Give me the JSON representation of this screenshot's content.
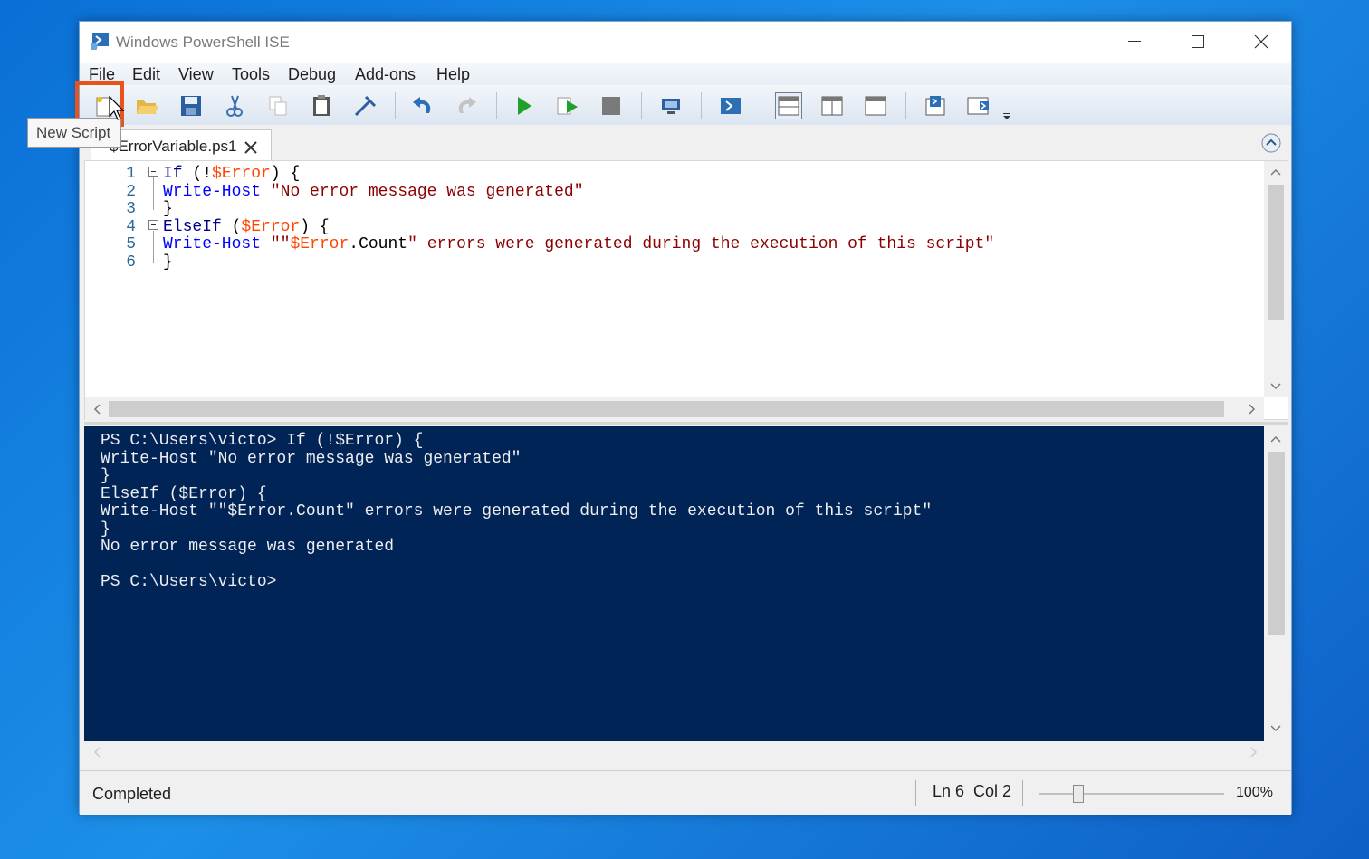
{
  "window": {
    "title": "Windows PowerShell ISE"
  },
  "menu": [
    "File",
    "Edit",
    "View",
    "Tools",
    "Debug",
    "Add-ons",
    "Help"
  ],
  "toolbar": {
    "tooltip": "New Script",
    "buttons": [
      "new-script",
      "open",
      "save",
      "cut",
      "copy",
      "paste",
      "clear-console",
      "undo",
      "redo",
      "run-script",
      "run-selection",
      "stop",
      "new-remote-tab",
      "start-powershell",
      "show-script-top",
      "show-script-right",
      "show-script-maximized",
      "show-command-window",
      "show-command-addon",
      "customize"
    ]
  },
  "tab": {
    "label": "$ErrorVariable.ps1"
  },
  "editor": {
    "line_numbers": [
      "1",
      "2",
      "3",
      "4",
      "5",
      "6"
    ],
    "lines": [
      [
        {
          "t": "If",
          "c": "kw"
        },
        {
          "t": " (",
          "c": "plain"
        },
        {
          "t": "!",
          "c": "plain"
        },
        {
          "t": "$Error",
          "c": "var"
        },
        {
          "t": ") {",
          "c": "plain"
        }
      ],
      [
        {
          "t": "Write-Host",
          "c": "cmd"
        },
        {
          "t": " ",
          "c": "plain"
        },
        {
          "t": "\"No error message was generated\"",
          "c": "str"
        }
      ],
      [
        {
          "t": "}",
          "c": "plain"
        }
      ],
      [
        {
          "t": "ElseIf",
          "c": "kw"
        },
        {
          "t": " (",
          "c": "plain"
        },
        {
          "t": "$Error",
          "c": "var"
        },
        {
          "t": ") {",
          "c": "plain"
        }
      ],
      [
        {
          "t": "Write-Host",
          "c": "cmd"
        },
        {
          "t": " ",
          "c": "plain"
        },
        {
          "t": "\"\"",
          "c": "str"
        },
        {
          "t": "$Error",
          "c": "var"
        },
        {
          "t": ".",
          "c": "plain"
        },
        {
          "t": "Count",
          "c": "plain"
        },
        {
          "t": "\" errors were generated during the execution of this script\"",
          "c": "str"
        }
      ],
      [
        {
          "t": "}",
          "c": "plain"
        }
      ]
    ]
  },
  "console": {
    "lines": [
      "PS C:\\Users\\victo> If (!$Error) {",
      "Write-Host \"No error message was generated\"",
      "}",
      "ElseIf ($Error) {",
      "Write-Host \"\"$Error.Count\" errors were generated during the execution of this script\"",
      "}",
      "No error message was generated",
      "",
      "PS C:\\Users\\victo>"
    ]
  },
  "status": {
    "text": "Completed",
    "position": "Ln 6  Col 2",
    "zoom": "100%",
    "zoom_slider_fraction": 0.25
  },
  "colors": {
    "console_bg": "#012456",
    "highlight": "#e8531c",
    "desktop": "#0a6fd6"
  }
}
